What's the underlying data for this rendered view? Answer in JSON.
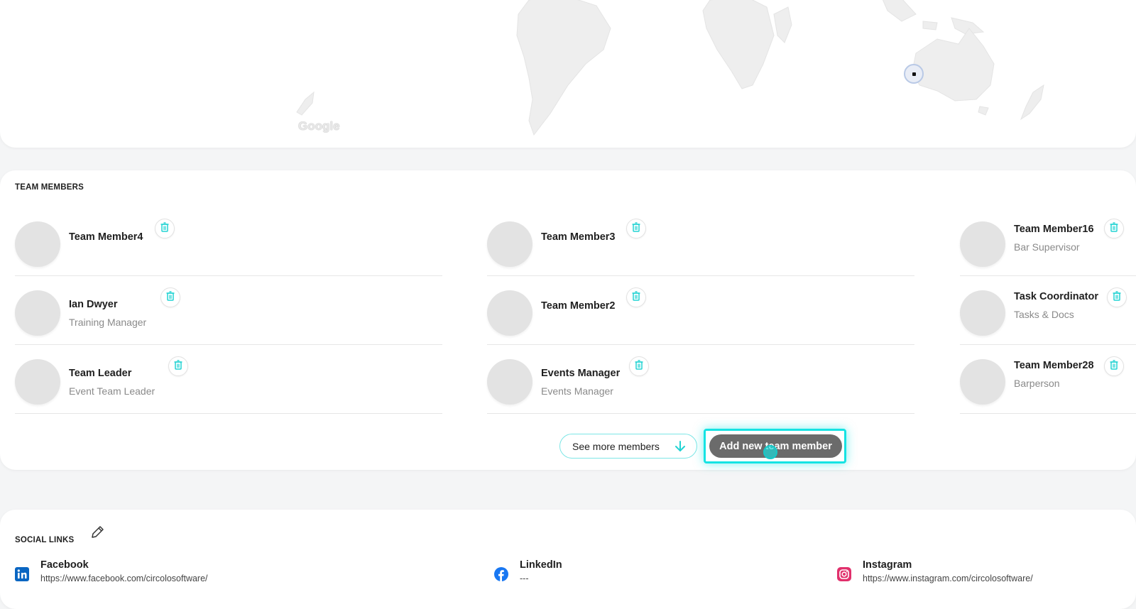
{
  "map": {
    "google_logo": "Google"
  },
  "team": {
    "title": "TEAM MEMBERS",
    "members": [
      {
        "name": "Team Member4",
        "role": ""
      },
      {
        "name": "Team Member3",
        "role": ""
      },
      {
        "name": "Team Member16",
        "role": "Bar Supervisor"
      },
      {
        "name": "Ian Dwyer",
        "role": "Training Manager"
      },
      {
        "name": "Team Member2",
        "role": ""
      },
      {
        "name": "Task Coordinator",
        "role": "Tasks & Docs"
      },
      {
        "name": "Team Leader",
        "role": "Event Team Leader"
      },
      {
        "name": "Events Manager",
        "role": "Events Manager"
      },
      {
        "name": "Team Member28",
        "role": "Barperson"
      }
    ],
    "see_more_label": "See more members",
    "add_label": "Add new team member"
  },
  "social": {
    "title": "SOCIAL LINKS",
    "links": [
      {
        "label": "Facebook",
        "value": "https://www.facebook.com/circolosoftware/"
      },
      {
        "label": "LinkedIn",
        "value": "---"
      },
      {
        "label": "Instagram",
        "value": "https://www.instagram.com/circolosoftware/"
      }
    ]
  },
  "colors": {
    "accent": "#16e3e3",
    "trash_icon": "#22d3d3",
    "button_dark": "#6b6b6b",
    "linkedin_blue": "#0a66c2",
    "facebook_blue": "#1877f2",
    "instagram_pink": "#e1306c"
  }
}
